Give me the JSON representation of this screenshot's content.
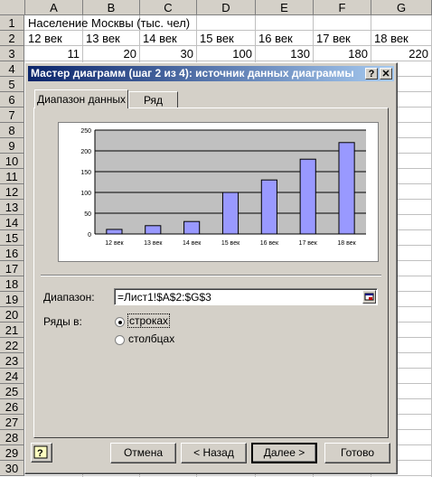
{
  "sheet": {
    "columns": [
      "A",
      "B",
      "C",
      "D",
      "E",
      "F",
      "G"
    ],
    "rows": [
      "1",
      "2",
      "3",
      "4",
      "5",
      "6",
      "7",
      "8",
      "9",
      "10",
      "11",
      "12",
      "13",
      "14",
      "15",
      "16",
      "17",
      "18",
      "19",
      "20",
      "21",
      "22",
      "23",
      "24",
      "25",
      "26",
      "27",
      "28",
      "29",
      "30"
    ],
    "a1": "Население Москвы (тыс. чел)",
    "row2": [
      "12 век",
      "13 век",
      "14 век",
      "15 век",
      "16 век",
      "17 век",
      "18 век"
    ],
    "row3": [
      "11",
      "20",
      "30",
      "100",
      "130",
      "180",
      "220"
    ]
  },
  "dialog": {
    "title": "Мастер диаграмм (шаг 2 из 4): источник данных диаграммы",
    "help_glyph": "?",
    "close_glyph": "✕",
    "tabs": [
      "Диапазон данных",
      "Ряд"
    ],
    "range_label": "Диапазон:",
    "range_value": "=Лист1!$A$2:$G$3",
    "series_in_label": "Ряды в:",
    "radio_rows": "строках",
    "radio_cols": "столбцах",
    "selected": "rows",
    "buttons": {
      "cancel": "Отмена",
      "back": "< Назад",
      "next": "Далее >",
      "finish": "Готово"
    }
  },
  "chart_data": {
    "type": "bar",
    "categories": [
      "12 век",
      "13 век",
      "14 век",
      "15 век",
      "16 век",
      "17 век",
      "18 век"
    ],
    "values": [
      11,
      20,
      30,
      100,
      130,
      180,
      220
    ],
    "ylim": [
      0,
      250
    ],
    "yticks": [
      0,
      50,
      100,
      150,
      200,
      250
    ],
    "grid": true,
    "colors": {
      "bar": "#9999ff",
      "plot_bg": "#c0c0c0"
    }
  }
}
